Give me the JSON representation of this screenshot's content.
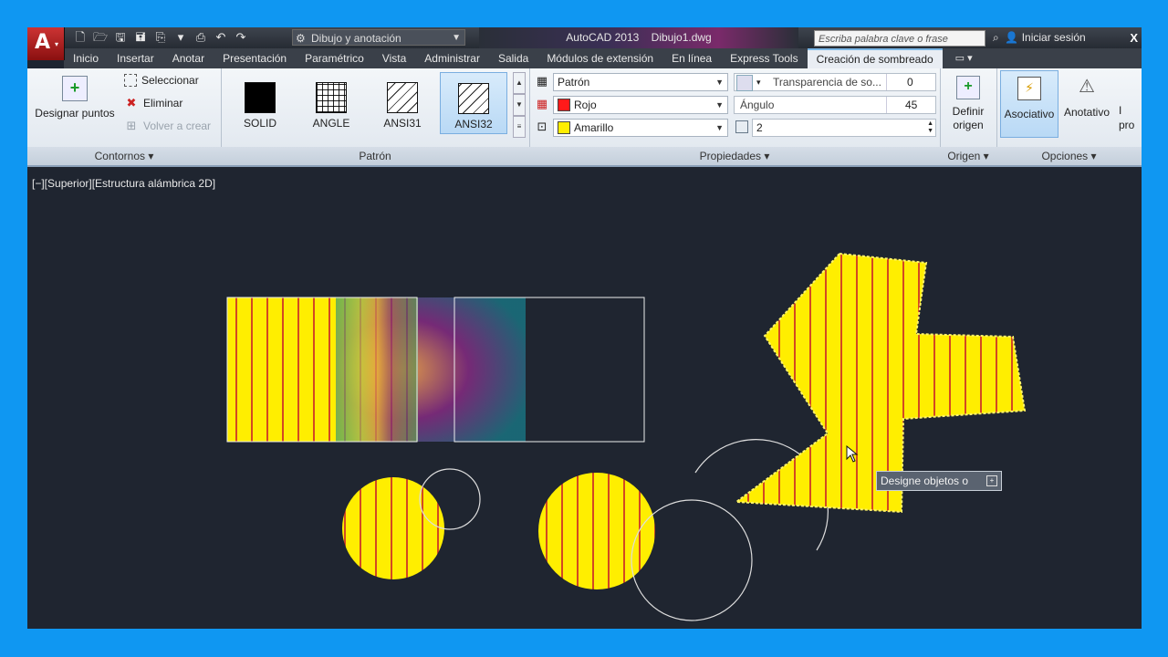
{
  "titlebar": {
    "workspace": "Dibujo y anotación",
    "app_title": "AutoCAD 2013    Dibujo1.dwg",
    "search_placeholder": "Escriba palabra clave o frase",
    "sign_in": "Iniciar sesión",
    "close": "X"
  },
  "tabs": [
    "Inicio",
    "Insertar",
    "Anotar",
    "Presentación",
    "Paramétrico",
    "Vista",
    "Administrar",
    "Salida",
    "Módulos de extensión",
    "En línea",
    "Express Tools",
    "Creación de sombreado"
  ],
  "tab_extra": "▭ ▾",
  "ribbon": {
    "contornos": {
      "title": "Contornos ▾",
      "designar_puntos": "Designar puntos",
      "seleccionar": "Seleccionar",
      "eliminar": "Eliminar",
      "volver_a_crear": "Volver a crear"
    },
    "patron": {
      "title": "Patrón",
      "patterns": [
        "SOLID",
        "ANGLE",
        "ANSI31",
        "ANSI32"
      ]
    },
    "propiedades": {
      "title": "Propiedades ▾",
      "tipo": "Patrón",
      "color": "Rojo",
      "color_hex": "#ff1a1a",
      "fondo": "Amarillo",
      "fondo_hex": "#ffee00",
      "transparencia_label": "Transparencia de so...",
      "transparencia_value": "0",
      "angulo_label": "Ángulo",
      "angulo_value": "45",
      "escala_value": "2"
    },
    "origen": {
      "title": "Origen ▾",
      "definir": "Definir",
      "origen": "origen"
    },
    "opciones": {
      "title": "Opciones ▾",
      "asociativo": "Asociativo",
      "anotativo": "Anotativo",
      "extra": "I\npro"
    }
  },
  "canvas": {
    "viewport_label": "[−][Superior][Estructura alámbrica 2D]",
    "tooltip": "Designe objetos o"
  },
  "colors": {
    "hatch_fill": "#ffee00",
    "hatch_line": "#c8202a",
    "canvas_bg": "#1f2530",
    "frame": "#0f97f2"
  }
}
